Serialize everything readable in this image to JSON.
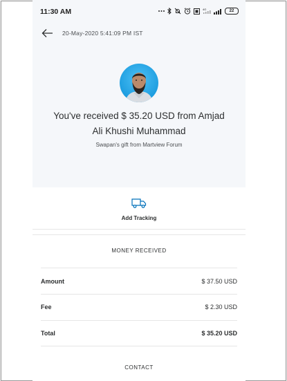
{
  "status_bar": {
    "time": "11:30 AM",
    "battery": "22",
    "icons": [
      "dots-icon",
      "bluetooth-icon",
      "mute-icon",
      "alarm-icon",
      "data-saver-icon",
      "signal-4g-icon",
      "signal-icon",
      "battery-icon"
    ]
  },
  "header": {
    "back_icon": "arrow-left-icon",
    "datetime": "20-May-2020 5:41:09 PM IST"
  },
  "transaction": {
    "headline_line1": "You've received $ 35.20 USD from Amjad",
    "headline_line2": "Ali Khushi Muhammad",
    "note": "Swapan's gift from Martview Forum"
  },
  "actions": {
    "tracking_icon": "truck-icon",
    "tracking_label": "Add Tracking"
  },
  "money_received": {
    "title": "MONEY RECEIVED",
    "rows": [
      {
        "label": "Amount",
        "value": "$ 37.50 USD"
      },
      {
        "label": "Fee",
        "value": "$ 2.30 USD"
      },
      {
        "label": "Total",
        "value": "$ 35.20 USD"
      }
    ]
  },
  "contact": {
    "title": "CONTACT"
  },
  "colors": {
    "accent": "#0070ba",
    "hero_background": "#f5f7fa",
    "text": "#2c2e2f"
  }
}
